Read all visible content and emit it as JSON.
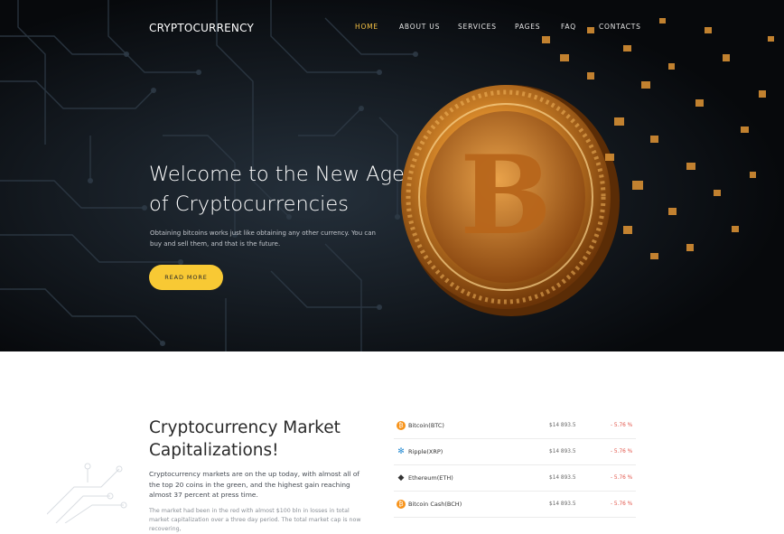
{
  "header": {
    "brand": "CRYPTOCURRENCY",
    "nav": [
      "HOME",
      "ABOUT US",
      "SERVICES",
      "PAGES",
      "FAQ",
      "CONTACTS"
    ],
    "active_nav": "HOME"
  },
  "hero": {
    "title": "Welcome to the New Age of Cryptocurrencies",
    "subtitle": "Obtaining bitcoins works just like obtaining any other currency. You can buy and sell them, and that is the future.",
    "button": "READ MORE"
  },
  "market": {
    "title": "Cryptocurrency Market Capitalizations!",
    "paragraph1": "Cryptocurrency markets are on the up today, with almost all of the top 20 coins in the green, and the highest gain reaching almost 37 percent at press time.",
    "paragraph2": "The market had been in the red with almost $100 bln in losses in total market capitalization over a three day period. The total market cap is now recovering,",
    "coins": [
      {
        "name": "Bitcoin(BTC)",
        "price": "$14 893.5",
        "change": "- 5.76 %",
        "icon": "bitcoin-icon",
        "color": "#f7931a"
      },
      {
        "name": "Ripple(XRP)",
        "price": "$14 893.5",
        "change": "- 5.76 %",
        "icon": "ripple-icon",
        "color": "#2b8ed4"
      },
      {
        "name": "Ethereum(ETH)",
        "price": "$14 893.5",
        "change": "- 5.76 %",
        "icon": "ethereum-icon",
        "color": "#333333"
      },
      {
        "name": "Bitcoin Cash(BCH)",
        "price": "$14 893.5",
        "change": "- 5.76 %",
        "icon": "bitcoin-cash-icon",
        "color": "#f7931a"
      }
    ]
  },
  "colors": {
    "accent": "#f8c934",
    "nav_active": "#f6c244",
    "negative": "#e2554a",
    "hero_bg": "#0d1116"
  }
}
